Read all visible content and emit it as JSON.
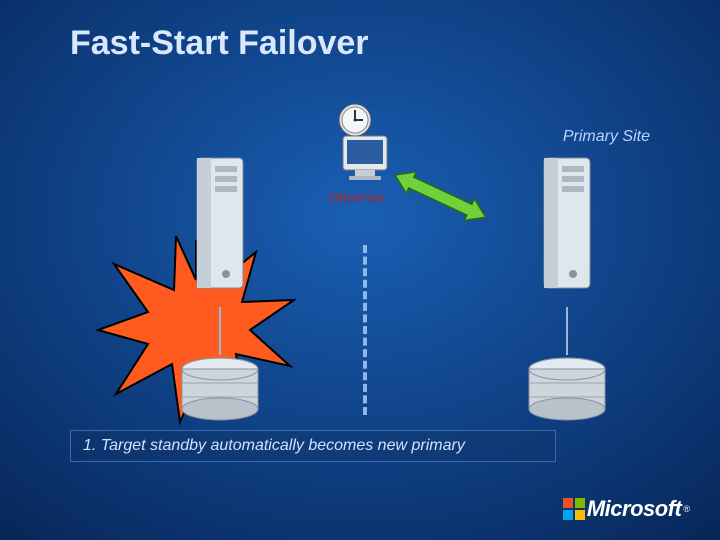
{
  "title": "Fast-Start Failover",
  "labels": {
    "primary_site": "Primary Site",
    "observer": "Observer"
  },
  "caption": "1. Target standby automatically becomes new primary",
  "logo": {
    "text": "Microsoft",
    "registered": "®"
  },
  "colors": {
    "burst_fill": "#ff5a1f",
    "burst_stroke": "#000",
    "arrow_fill": "#6fd13b",
    "arrow_stroke": "#2b6612"
  }
}
